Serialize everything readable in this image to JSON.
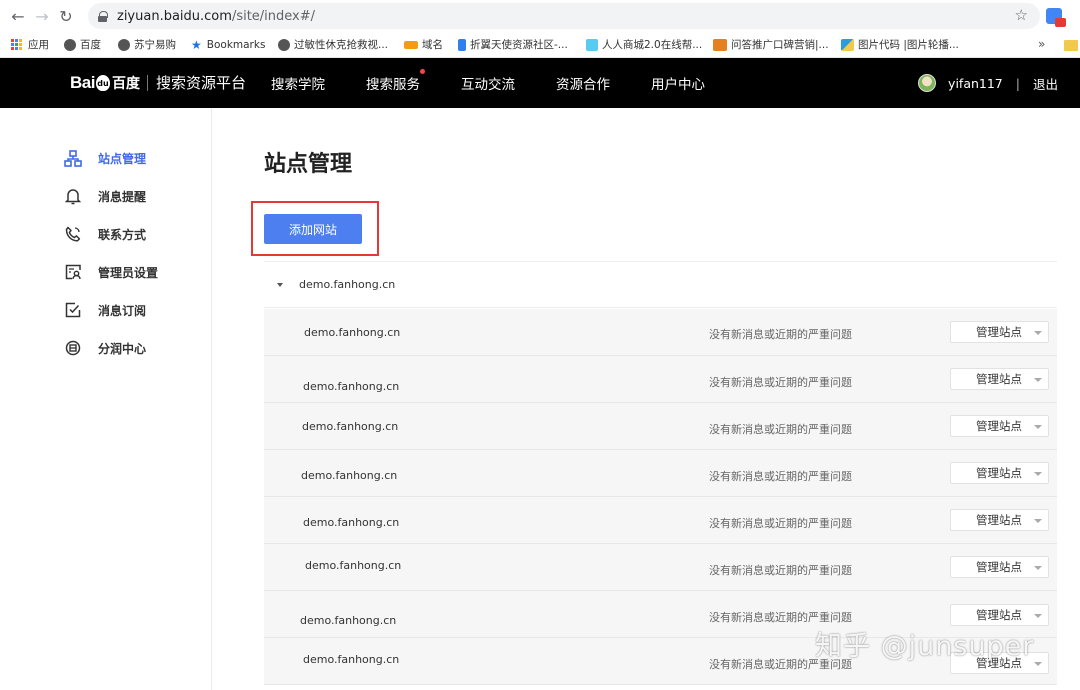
{
  "browser": {
    "url_host": "ziyuan.baidu.com",
    "url_path": "/site/index#/",
    "bookmarks": [
      {
        "label": "应用",
        "icon": "apps-grid-icon"
      },
      {
        "label": "百度",
        "icon": "globe-icon"
      },
      {
        "label": "苏宁易购",
        "icon": "globe-icon"
      },
      {
        "label": "Bookmarks",
        "icon": "star-icon"
      },
      {
        "label": "过敏性休克抢救视...",
        "icon": "globe-icon"
      },
      {
        "label": "域名",
        "icon": "site-favicon-icon"
      },
      {
        "label": "折翼天使资源社区-...",
        "icon": "site-favicon-icon"
      },
      {
        "label": "人人商城2.0在线帮...",
        "icon": "site-favicon-icon"
      },
      {
        "label": "问答推广口碑营销|...",
        "icon": "site-favicon-icon"
      },
      {
        "label": "图片代码 |图片轮播...",
        "icon": "site-favicon-icon"
      }
    ],
    "more": "»"
  },
  "header": {
    "logo_bai": "Bai",
    "logo_du": "du",
    "logo_cn": "百度",
    "platform": "搜索资源平台",
    "nav": [
      {
        "label": "搜索学院",
        "dot": false
      },
      {
        "label": "搜索服务",
        "dot": true
      },
      {
        "label": "互动交流",
        "dot": false
      },
      {
        "label": "资源合作",
        "dot": false
      },
      {
        "label": "用户中心",
        "dot": false
      }
    ],
    "username": "yifan117",
    "separator": "|",
    "logout": "退出",
    "accent_dot_color": "#f5444b"
  },
  "sidebar": {
    "items": [
      {
        "label": "站点管理",
        "icon": "sitemap-icon",
        "active": true
      },
      {
        "label": "消息提醒",
        "icon": "bell-icon",
        "active": false
      },
      {
        "label": "联系方式",
        "icon": "phone-icon",
        "active": false
      },
      {
        "label": "管理员设置",
        "icon": "admin-card-icon",
        "active": false
      },
      {
        "label": "消息订阅",
        "icon": "subscribe-check-icon",
        "active": false
      },
      {
        "label": "分润中心",
        "icon": "share-profit-icon",
        "active": false
      }
    ],
    "active_color": "#3f6be9"
  },
  "main": {
    "title": "站点管理",
    "add_button": "添加网站",
    "group_domain": "demo.fanhong.cn",
    "rows": [
      {
        "domain": "demo.fanhong.cn",
        "status": "没有新消息或近期的严重问题",
        "action": "管理站点"
      },
      {
        "domain": "demo.fanhong.cn",
        "status": "没有新消息或近期的严重问题",
        "action": "管理站点"
      },
      {
        "domain": "demo.fanhong.cn",
        "status": "没有新消息或近期的严重问题",
        "action": "管理站点"
      },
      {
        "domain": "demo.fanhong.cn",
        "status": "没有新消息或近期的严重问题",
        "action": "管理站点"
      },
      {
        "domain": "demo.fanhong.cn",
        "status": "没有新消息或近期的严重问题",
        "action": "管理站点"
      },
      {
        "domain": "demo.fanhong.cn",
        "status": "没有新消息或近期的严重问题",
        "action": "管理站点"
      },
      {
        "domain": "demo.fanhong.cn",
        "status": "没有新消息或近期的严重问题",
        "action": "管理站点"
      },
      {
        "domain": "demo.fanhong.cn",
        "status": "没有新消息或近期的严重问题",
        "action": "管理站点"
      }
    ],
    "button_color": "#4e7ff0",
    "highlight_color": "#e53935"
  },
  "watermark": "知乎 @junsuper"
}
